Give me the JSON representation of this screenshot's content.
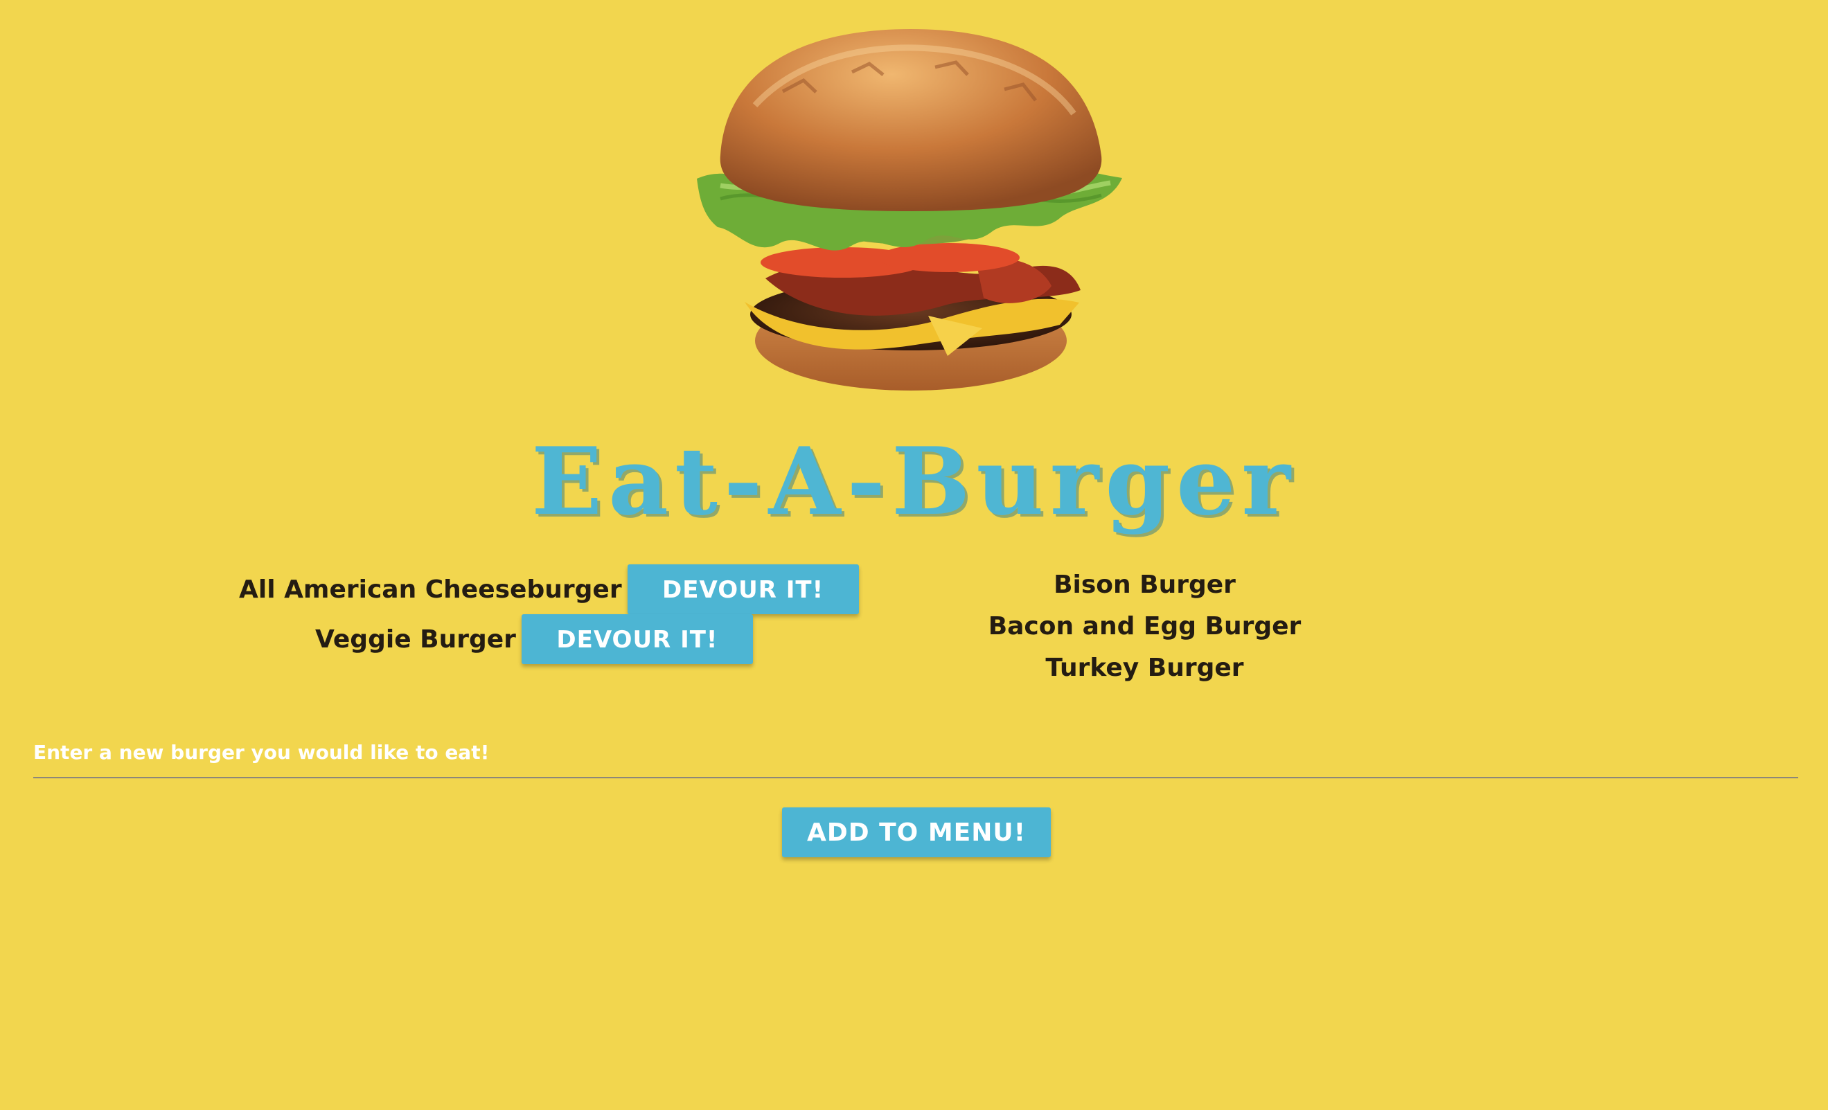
{
  "page": {
    "title": "Eat-A-Burger"
  },
  "hero": {
    "image_name": "burger-hero-image"
  },
  "menu": {
    "uneaten": [
      {
        "name": "All American Cheeseburger",
        "button_label": "DEVOUR IT!"
      },
      {
        "name": "Veggie Burger",
        "button_label": "DEVOUR IT!"
      }
    ],
    "devoured": [
      "Bison Burger",
      "Bacon and Egg Burger",
      "Turkey Burger"
    ]
  },
  "form": {
    "placeholder": "Enter a new burger you would like to eat!",
    "button_label": "ADD TO MENU!"
  },
  "colors": {
    "background": "#f2d64e",
    "accent": "#4db5d3",
    "text": "#241c12"
  }
}
